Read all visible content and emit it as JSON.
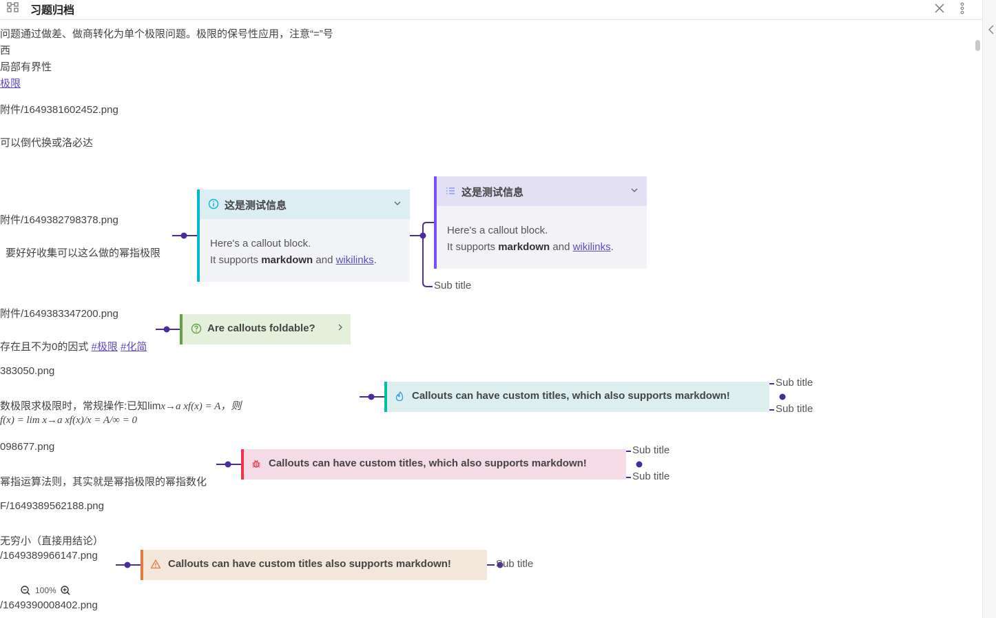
{
  "window": {
    "title": "习题归档"
  },
  "icons": {
    "app": "graph-icon",
    "close": "close-icon",
    "more": "more-vertical-icon",
    "collapse": "chevron-left-icon",
    "zoom_out": "zoom-out-icon",
    "zoom_in": "zoom-in-icon"
  },
  "colors": {
    "accent": "#4b2a9e",
    "link": "#5b4cc4",
    "info": "#00b8d4",
    "note": "#7c4dff",
    "question": "#64a042",
    "tip": "#00bfa5",
    "bug": "#f0334a",
    "warning": "#e5793d"
  },
  "lines": [
    {
      "text": "问题通过做差、做商转化为单个极限问题。极限的保号性应用，注意“=”号"
    },
    {
      "text": "西"
    },
    {
      "text": "局部有界性"
    },
    {
      "link": "极限"
    },
    {
      "text": "附件/1649381602452.png"
    },
    {
      "text": "可以倒代换或洛必达"
    },
    {
      "text": "附件/1649382798378.png"
    },
    {
      "text": "要好好收集可以这么做的幂指极限"
    },
    {
      "text": "附件/1649383347200.png"
    },
    {
      "text": "存在且不为0的因式 ",
      "tag1": "#极限",
      "tag2": "#化简"
    },
    {
      "text": "383050.png"
    },
    {
      "text": "数极限求极限时，常规操作:已知lim",
      "math": "x→a xf(x) = A，则"
    },
    {
      "math": "f(x) = lim x→a xf(x)/x = A/∞ = 0"
    },
    {
      "text": "098677.png"
    },
    {
      "text": "幂指运算法则，其实就是幂指极限的幂指数化"
    },
    {
      "text": "F/1649389562188.png"
    },
    {
      "text": "无穷小（直接用结论）"
    },
    {
      "text": "/1649389966147.png"
    },
    {
      "text": "/1649390008402.png"
    }
  ],
  "callouts": {
    "info": {
      "title": "这是测试信息",
      "body_line1": "Here's a callout block.",
      "body_pre": "It supports ",
      "body_bold": "markdown",
      "body_mid": " and ",
      "body_link": "wikilinks",
      "body_end": ".",
      "icon": "info-icon",
      "chevron": "chevron-down-icon"
    },
    "note": {
      "title": "这是测试信息",
      "body_line1": "Here's a callout block.",
      "body_pre": "It supports ",
      "body_bold": "markdown",
      "body_mid": " and ",
      "body_link": "wikilinks",
      "body_end": ".",
      "icon": "list-icon",
      "chevron": "chevron-down-icon",
      "subtitle": "Sub title"
    },
    "question": {
      "title": "Are callouts foldable?",
      "icon": "help-circle-icon",
      "chevron": "chevron-right-icon"
    },
    "tip": {
      "title": "Callouts can have custom titles, which also supports markdown!",
      "icon": "flame-icon",
      "sub1": "Sub title",
      "sub2": "Sub title"
    },
    "bug": {
      "title": "Callouts can have custom titles, which also supports markdown!",
      "icon": "bug-icon",
      "sub1": "Sub title",
      "sub2": "Sub title"
    },
    "warning": {
      "title": "Callouts can have custom titles also supports markdown!",
      "icon": "alert-triangle-icon",
      "sub": "Sub title"
    }
  },
  "zoom": {
    "value": "100%"
  }
}
